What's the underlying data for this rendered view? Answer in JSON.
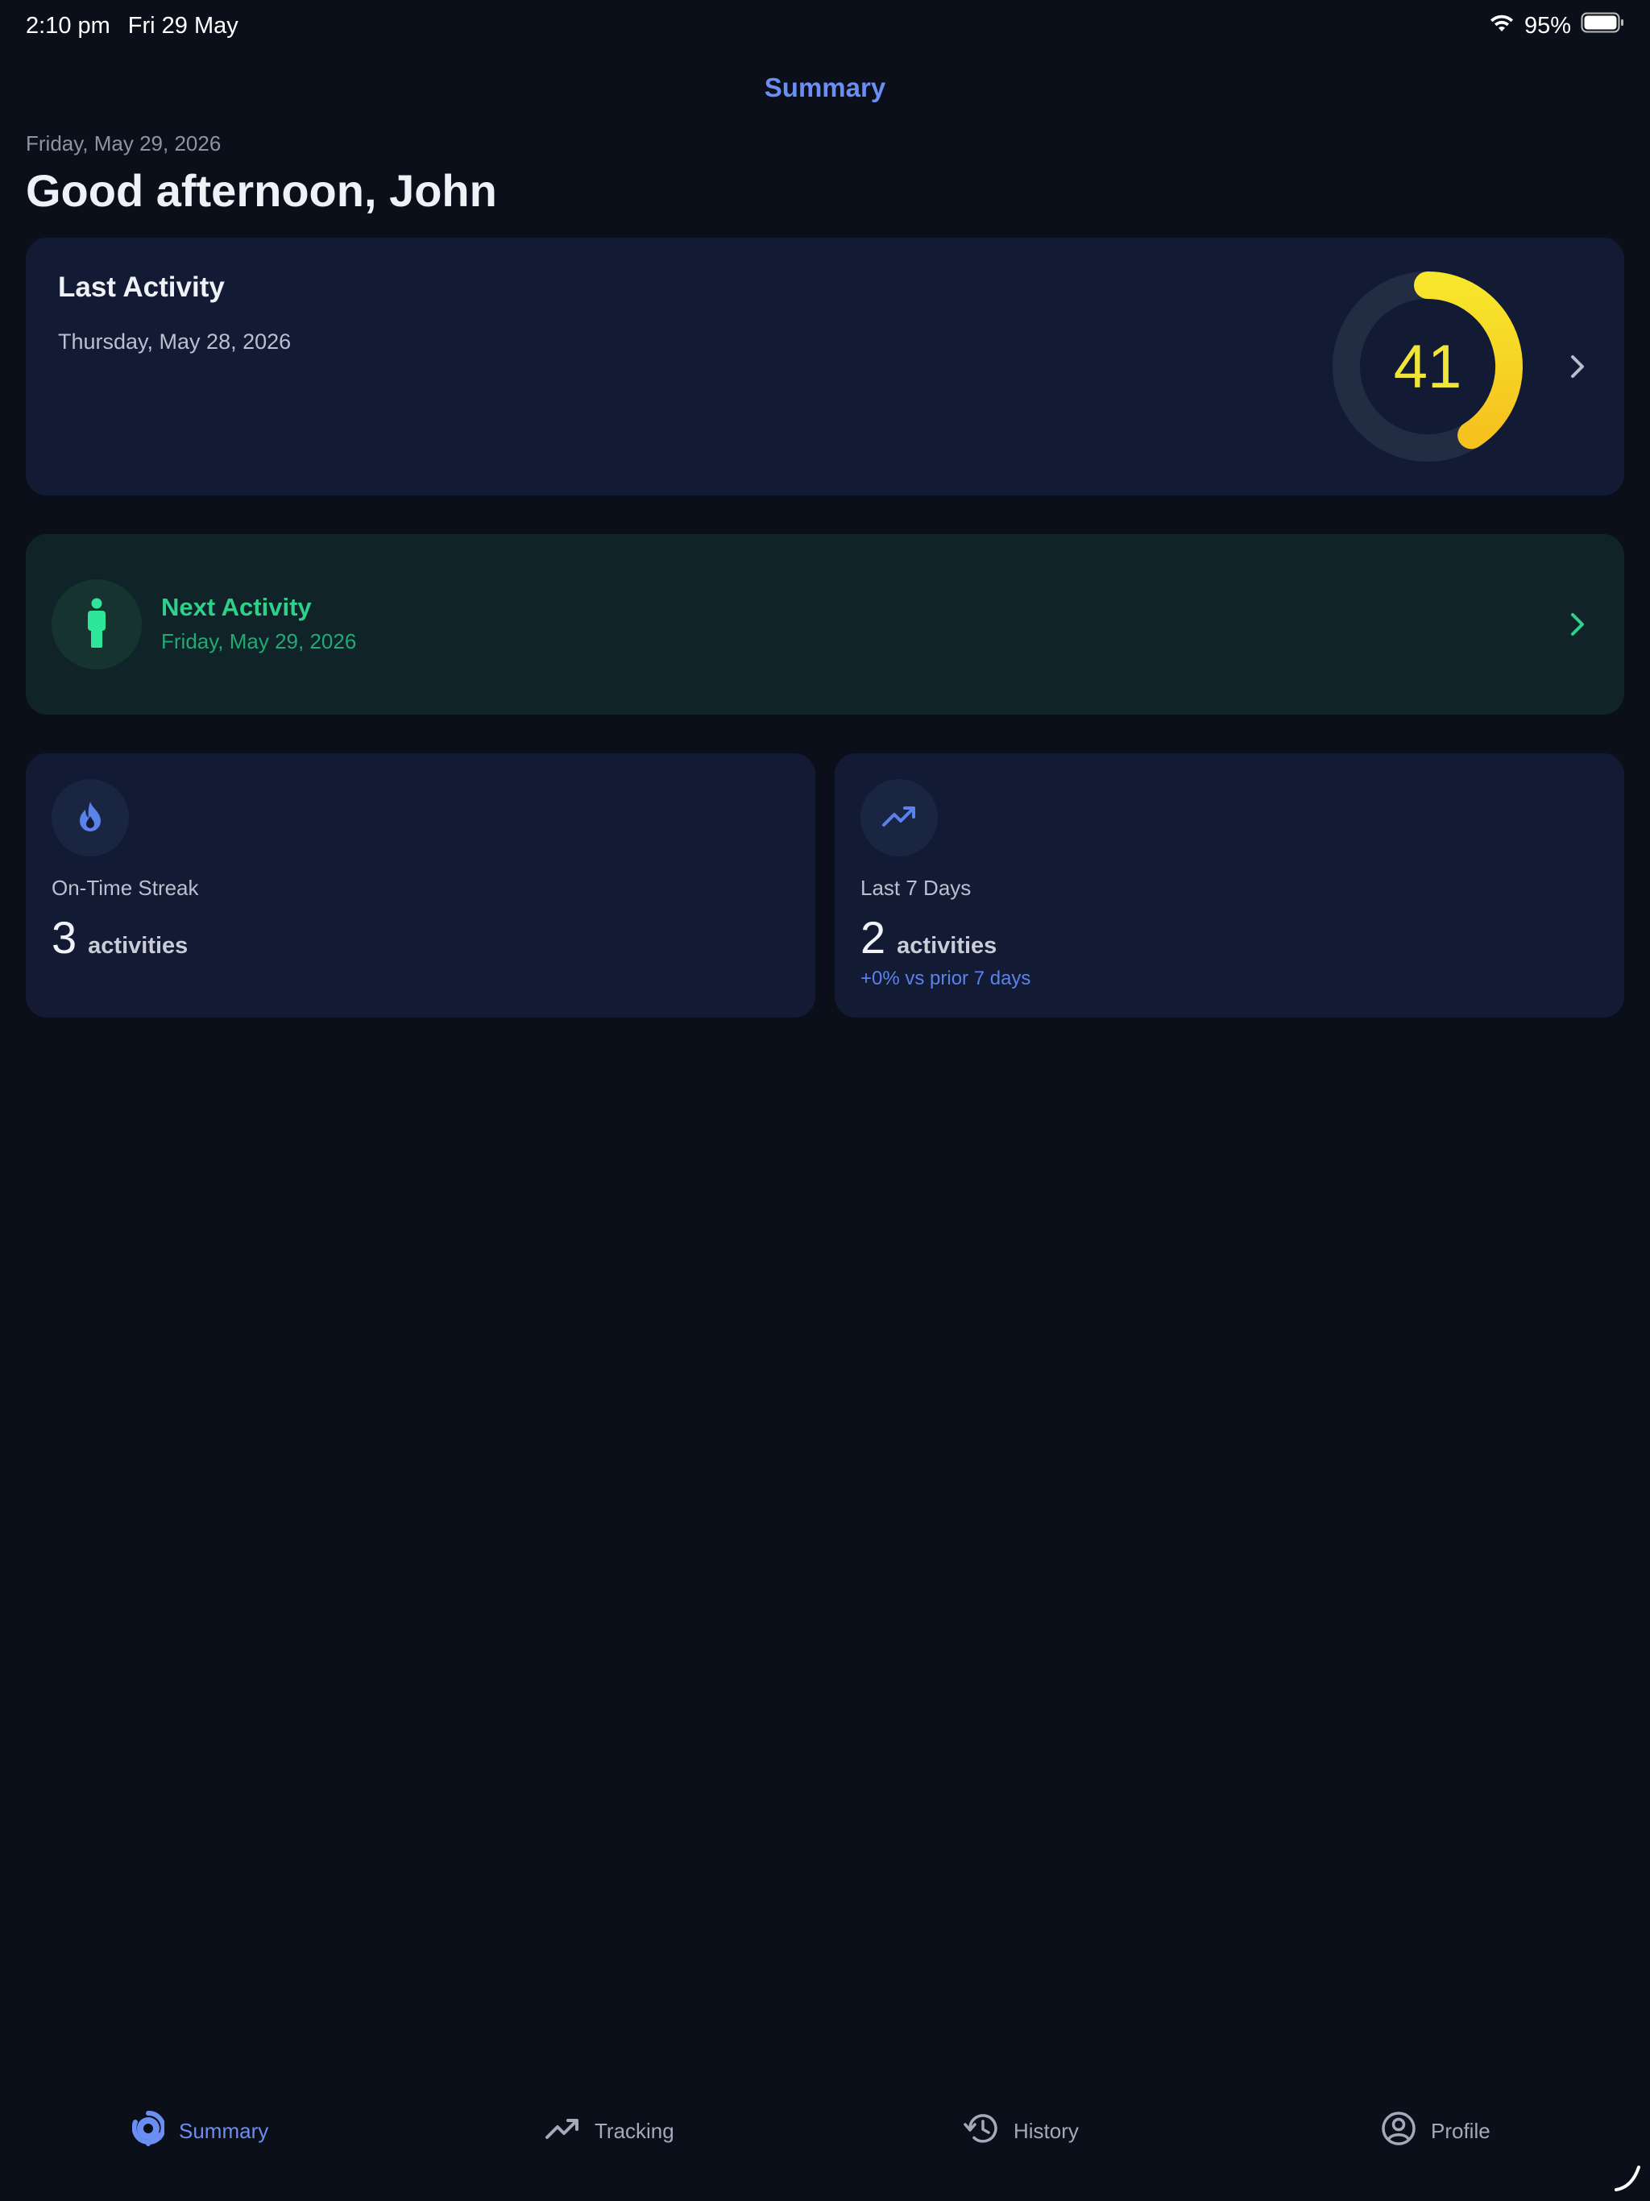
{
  "status_bar": {
    "time": "2:10 pm",
    "date": "Fri 29 May",
    "battery": "95%"
  },
  "nav": {
    "title": "Summary"
  },
  "header": {
    "date": "Friday, May 29, 2026",
    "greeting": "Good afternoon, John"
  },
  "last_activity": {
    "title": "Last Activity",
    "date": "Thursday, May 28, 2026",
    "score": "41",
    "score_fraction": 0.41,
    "ring_color": "#f7d21e"
  },
  "next_activity": {
    "title": "Next Activity",
    "date": "Friday, May 29, 2026",
    "accent_color": "#2fd08a"
  },
  "streak": {
    "label": "On-Time Streak",
    "value": "3",
    "unit": "activities"
  },
  "last7": {
    "label": "Last 7 Days",
    "value": "2",
    "unit": "activities",
    "delta": "+0% vs prior 7 days"
  },
  "tabs": [
    {
      "label": "Summary",
      "icon": "summary-icon",
      "active": true
    },
    {
      "label": "Tracking",
      "icon": "trending-up-icon",
      "active": false
    },
    {
      "label": "History",
      "icon": "history-icon",
      "active": false
    },
    {
      "label": "Profile",
      "icon": "profile-icon",
      "active": false
    }
  ],
  "colors": {
    "background": "#0a0f1a",
    "card": "#121b33",
    "accent": "#6b8ef5"
  }
}
